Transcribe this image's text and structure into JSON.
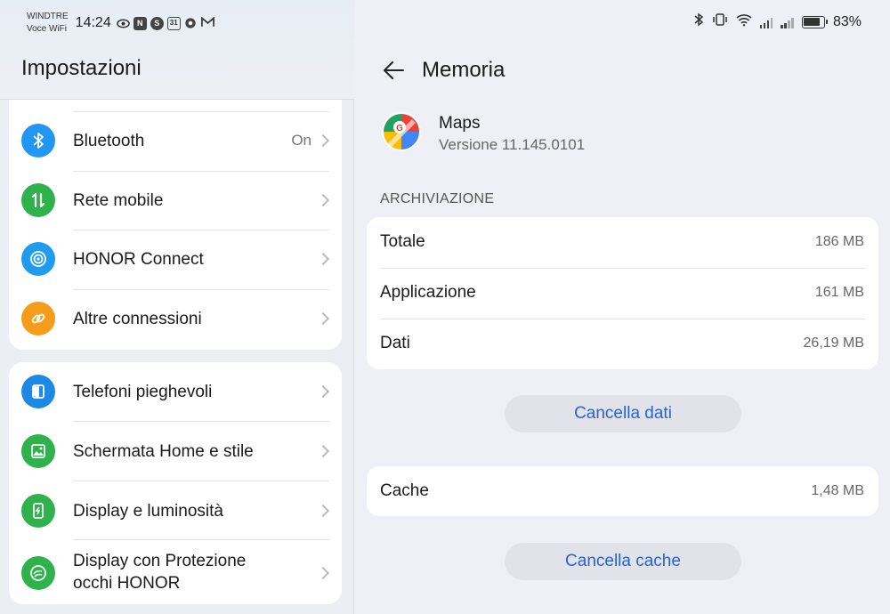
{
  "status_bar": {
    "carrier_line1": "WINDTRE",
    "carrier_line2": "Voce WiFi",
    "time": "14:24",
    "left_icons": [
      "eye-icon",
      "nfc-icon",
      "s-icon",
      "calendar-31-icon",
      "chrome-icon",
      "gmail-icon"
    ],
    "calendar_day": "31",
    "battery_percent": "83%",
    "battery_level": 0.83,
    "right_icons": [
      "bluetooth-icon",
      "vibrate-icon",
      "wifi-icon",
      "signal-icon",
      "signal-icon",
      "battery-icon"
    ]
  },
  "left_panel": {
    "title": "Impostazioni",
    "group1": [
      {
        "label": "Bluetooth",
        "value": "On",
        "icon": "bluetooth-icon",
        "color": "#2196f3"
      },
      {
        "label": "Rete mobile",
        "value": "",
        "icon": "mobile-data-icon",
        "color": "#2fb24c"
      },
      {
        "label": "HONOR Connect",
        "value": "",
        "icon": "honor-connect-icon",
        "color": "#1f9cf0"
      },
      {
        "label": "Altre connessioni",
        "value": "",
        "icon": "link-icon",
        "color": "#f59c1a"
      }
    ],
    "group2": [
      {
        "label": "Telefoni pieghevoli",
        "icon": "foldable-phone-icon",
        "color": "#1e88e5"
      },
      {
        "label": "Schermata Home e stile",
        "icon": "image-icon",
        "color": "#2fb24c"
      },
      {
        "label": "Display e luminosità",
        "icon": "display-brightness-icon",
        "color": "#2fb24c"
      },
      {
        "label_line1": "Display con Protezione",
        "label_line2": "occhi HONOR",
        "icon": "eye-comfort-icon",
        "color": "#2fb24c"
      }
    ]
  },
  "right_panel": {
    "title": "Memoria",
    "app": {
      "name": "Maps",
      "version": "Versione 11.145.0101"
    },
    "section_title": "ARCHIVIAZIONE",
    "storage": [
      {
        "key": "Totale",
        "value": "186 MB"
      },
      {
        "key": "Applicazione",
        "value": "161 MB"
      },
      {
        "key": "Dati",
        "value": "26,19 MB"
      }
    ],
    "clear_data_label": "Cancella dati",
    "cache": {
      "key": "Cache",
      "value": "1,48 MB"
    },
    "clear_cache_label": "Cancella cache"
  },
  "colors": {
    "accent": "#2a62d6",
    "background": "#eef0f5",
    "card": "#ffffff",
    "button_bg": "#e1e3e8"
  }
}
